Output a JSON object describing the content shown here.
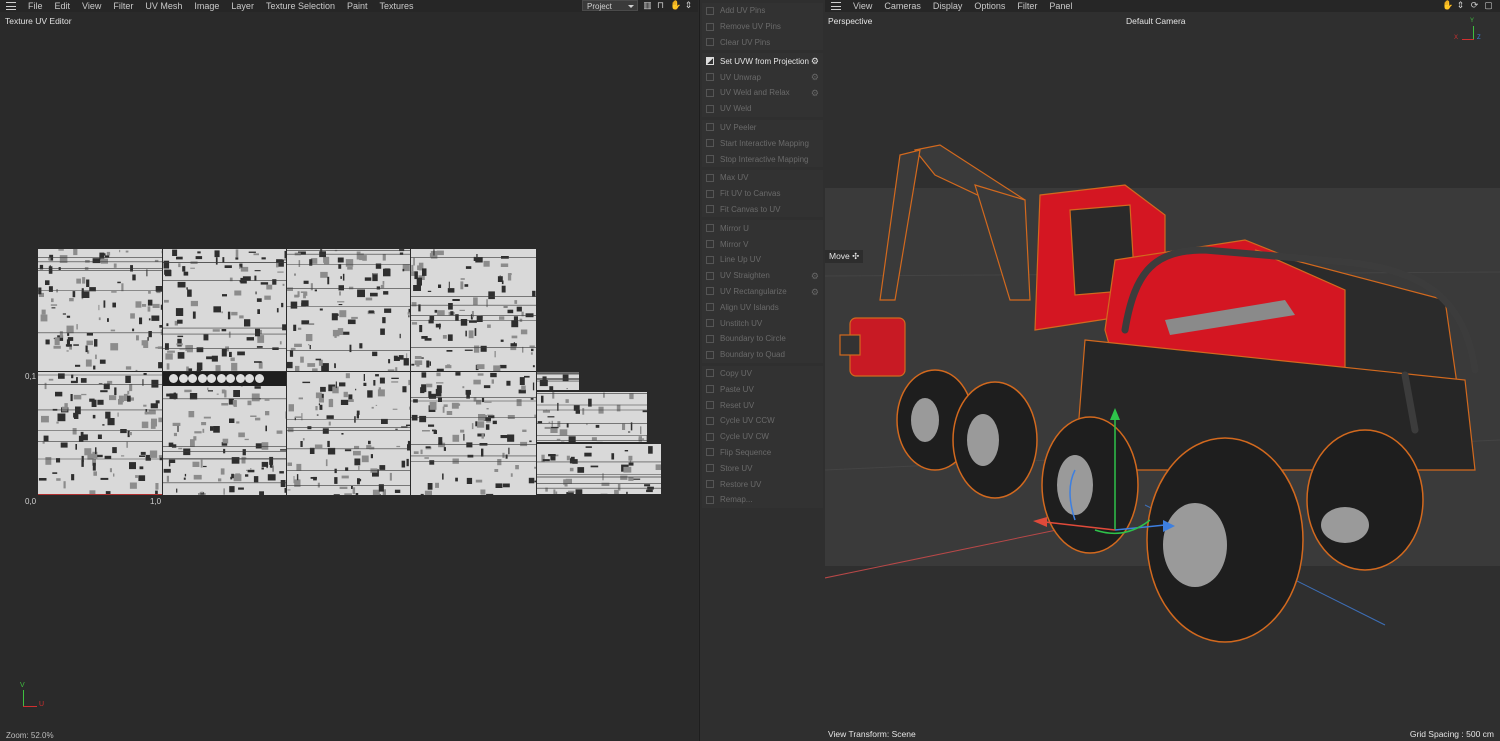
{
  "uv_editor": {
    "menu": [
      "File",
      "Edit",
      "View",
      "Filter",
      "UV Mesh",
      "Image",
      "Layer",
      "Texture Selection",
      "Paint",
      "Textures"
    ],
    "dropdown_value": "Project",
    "title": "Texture UV Editor",
    "labels": {
      "v1": "0,1",
      "origin": "0,0",
      "u1": "1,0"
    },
    "axis": {
      "v": "V",
      "u": "U"
    },
    "zoom": "Zoom: 52.0%"
  },
  "commands": {
    "groups": [
      {
        "items": [
          {
            "label": "Add UV Pins",
            "active": false,
            "gear": false
          },
          {
            "label": "Remove UV Pins",
            "active": false,
            "gear": false
          },
          {
            "label": "Clear UV Pins",
            "active": false,
            "gear": false
          }
        ]
      },
      {
        "items": [
          {
            "label": "Set UVW from Projection",
            "active": true,
            "gear": true
          },
          {
            "label": "UV Unwrap",
            "active": false,
            "gear": true
          },
          {
            "label": "UV Weld and Relax",
            "active": false,
            "gear": true
          },
          {
            "label": "UV Weld",
            "active": false,
            "gear": false
          }
        ]
      },
      {
        "items": [
          {
            "label": "UV Peeler",
            "active": false,
            "gear": false
          },
          {
            "label": "Start Interactive Mapping",
            "active": false,
            "gear": false
          },
          {
            "label": "Stop Interactive Mapping",
            "active": false,
            "gear": false
          }
        ]
      },
      {
        "items": [
          {
            "label": "Max UV",
            "active": false,
            "gear": false
          },
          {
            "label": "Fit UV to Canvas",
            "active": false,
            "gear": false
          },
          {
            "label": "Fit Canvas to UV",
            "active": false,
            "gear": false
          }
        ]
      },
      {
        "items": [
          {
            "label": "Mirror U",
            "active": false,
            "gear": false
          },
          {
            "label": "Mirror V",
            "active": false,
            "gear": false
          },
          {
            "label": "Line Up UV",
            "active": false,
            "gear": false
          },
          {
            "label": "UV Straighten",
            "active": false,
            "gear": true
          },
          {
            "label": "UV Rectangularize",
            "active": false,
            "gear": true
          },
          {
            "label": "Align UV Islands",
            "active": false,
            "gear": false
          },
          {
            "label": "Unstitch UV",
            "active": false,
            "gear": false
          },
          {
            "label": "Boundary to Circle",
            "active": false,
            "gear": false
          },
          {
            "label": "Boundary to Quad",
            "active": false,
            "gear": false
          }
        ]
      },
      {
        "items": [
          {
            "label": "Copy UV",
            "active": false,
            "gear": false
          },
          {
            "label": "Paste UV",
            "active": false,
            "gear": false
          },
          {
            "label": "Reset UV",
            "active": false,
            "gear": false
          },
          {
            "label": "Cycle UV CCW",
            "active": false,
            "gear": false
          },
          {
            "label": "Cycle UV CW",
            "active": false,
            "gear": false
          },
          {
            "label": "Flip Sequence",
            "active": false,
            "gear": false
          },
          {
            "label": "Store UV",
            "active": false,
            "gear": false
          },
          {
            "label": "Restore UV",
            "active": false,
            "gear": false
          },
          {
            "label": "Remap...",
            "active": false,
            "gear": false
          }
        ]
      }
    ]
  },
  "viewport": {
    "menu": [
      "View",
      "Cameras",
      "Display",
      "Options",
      "Filter",
      "Panel"
    ],
    "mode": "Perspective",
    "camera": "Default Camera",
    "tool": "Move",
    "view_transform": "View Transform: Scene",
    "grid_spacing": "Grid Spacing : 500 cm",
    "axes": {
      "x": "X",
      "y": "Y",
      "z": "Z"
    }
  },
  "colors": {
    "machine_red": "#d41622",
    "selection_orange": "#d2691e",
    "bg": "#2a2a2a"
  }
}
